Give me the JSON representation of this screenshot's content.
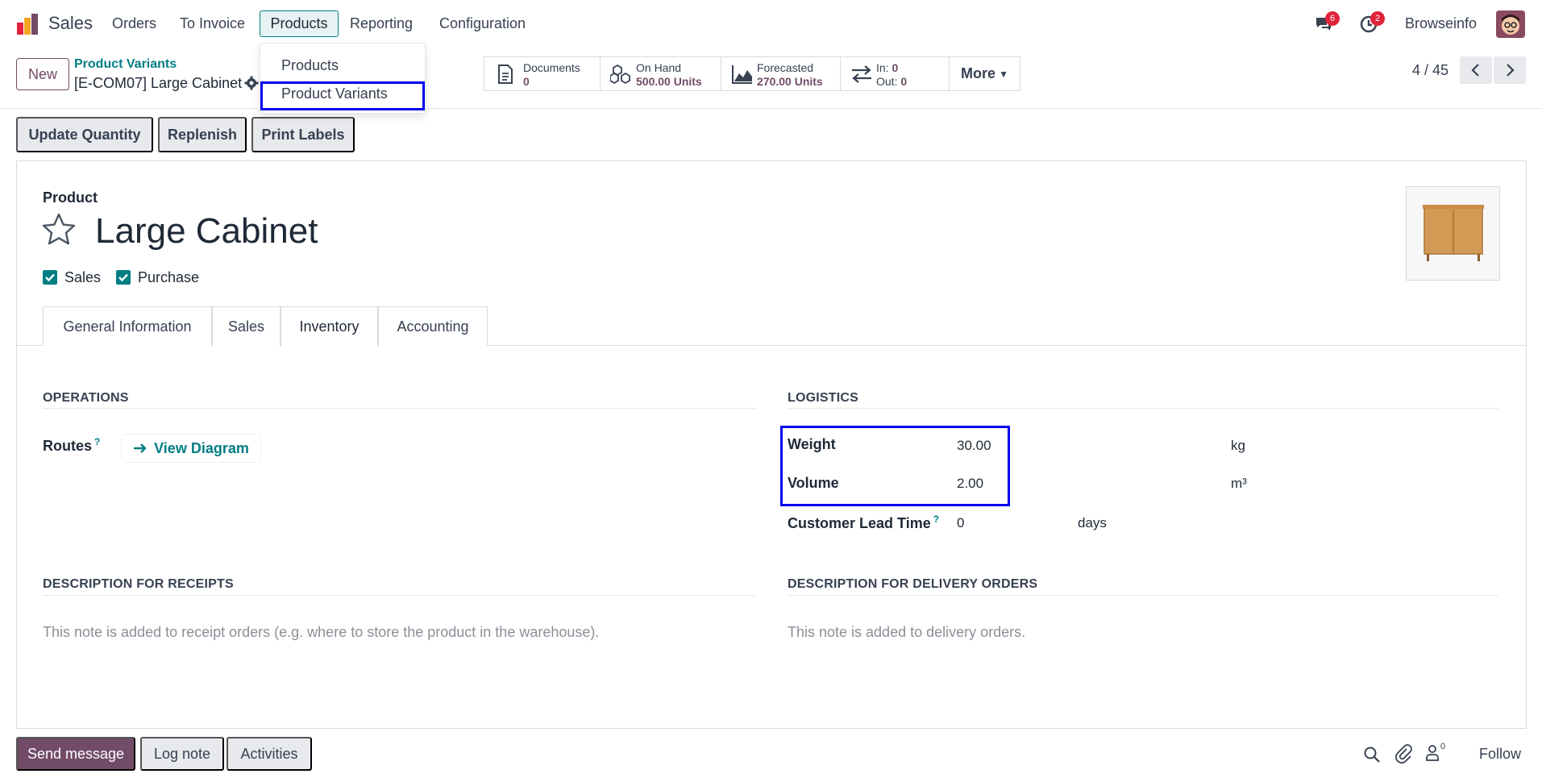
{
  "navbar": {
    "app_name": "Sales",
    "menu": [
      "Orders",
      "To Invoice",
      "Products",
      "Reporting",
      "Configuration"
    ],
    "messages_count": "6",
    "activities_count": "2",
    "user_name": "Browseinfo"
  },
  "dropdown": {
    "items": [
      "Products",
      "Product Variants"
    ]
  },
  "control": {
    "new_label": "New",
    "breadcrumb_parent": "Product Variants",
    "breadcrumb_current": "[E-COM07] Large Cabinet",
    "pager": "4 / 45"
  },
  "smart_buttons": {
    "documents": {
      "label": "Documents",
      "value": "0"
    },
    "on_hand": {
      "label": "On Hand",
      "value": "500.00 Units"
    },
    "forecasted": {
      "label": "Forecasted",
      "value": "270.00 Units"
    },
    "in_label": "In:",
    "in_value": "0",
    "out_label": "Out:",
    "out_value": "0",
    "more": "More"
  },
  "actions": [
    "Update Quantity",
    "Replenish",
    "Print Labels"
  ],
  "form": {
    "product_label": "Product",
    "title": "Large Cabinet",
    "sales_check": "Sales",
    "purchase_check": "Purchase",
    "tabs": [
      "General Information",
      "Sales",
      "Inventory",
      "Accounting"
    ],
    "operations_title": "OPERATIONS",
    "routes_label": "Routes",
    "qmark": "?",
    "view_diagram": "View Diagram",
    "logistics_title": "LOGISTICS",
    "weight_label": "Weight",
    "weight_value": "30.00",
    "weight_unit": "kg",
    "volume_label": "Volume",
    "volume_value": "2.00",
    "volume_unit": "m³",
    "lead_label": "Customer Lead Time",
    "lead_value": "0",
    "lead_unit": "days",
    "receipts_title": "DESCRIPTION FOR RECEIPTS",
    "receipts_placeholder": "This note is added to receipt orders (e.g. where to store the product in the warehouse).",
    "delivery_title": "DESCRIPTION FOR DELIVERY ORDERS",
    "delivery_placeholder": "This note is added to delivery orders."
  },
  "chatter": {
    "send_message": "Send message",
    "log_note": "Log note",
    "activities": "Activities",
    "followers_count": "0",
    "follow": "Follow"
  },
  "colors": {
    "brand": "#714b67",
    "accent": "#017e84",
    "highlight": "#0000ee",
    "badge": "#e0233a"
  }
}
